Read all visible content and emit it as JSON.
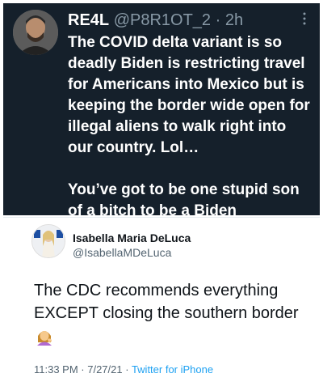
{
  "tweet_top": {
    "display_name": "RE4L",
    "handle": "@P8R1OT_2",
    "separator": " · ",
    "time": "2h",
    "paragraph_1": "The COVID delta variant is so deadly Biden is restricting travel for Americans into Mexico but is keeping the border wide open for illegal aliens to walk right into our country. Lol…",
    "paragraph_2": "You’ve got to be one stupid son of a bitch to be a Biden supporter.",
    "background_color": "#15202b",
    "text_color": "#ffffff",
    "handle_color": "#8899a6",
    "more_icon": "more-vertical-icon"
  },
  "tweet_bottom": {
    "display_name": "Isabella Maria DeLuca",
    "handle": "@IsabellaMDeLuca",
    "text": "The CDC recommends everything EXCEPT closing the southern border",
    "emoji_icon": "woman-tipping-hand-emoji",
    "timestamp": "11:33 PM · 7/27/21 · ",
    "source": "Twitter for iPhone",
    "source_color": "#1da1f2"
  }
}
